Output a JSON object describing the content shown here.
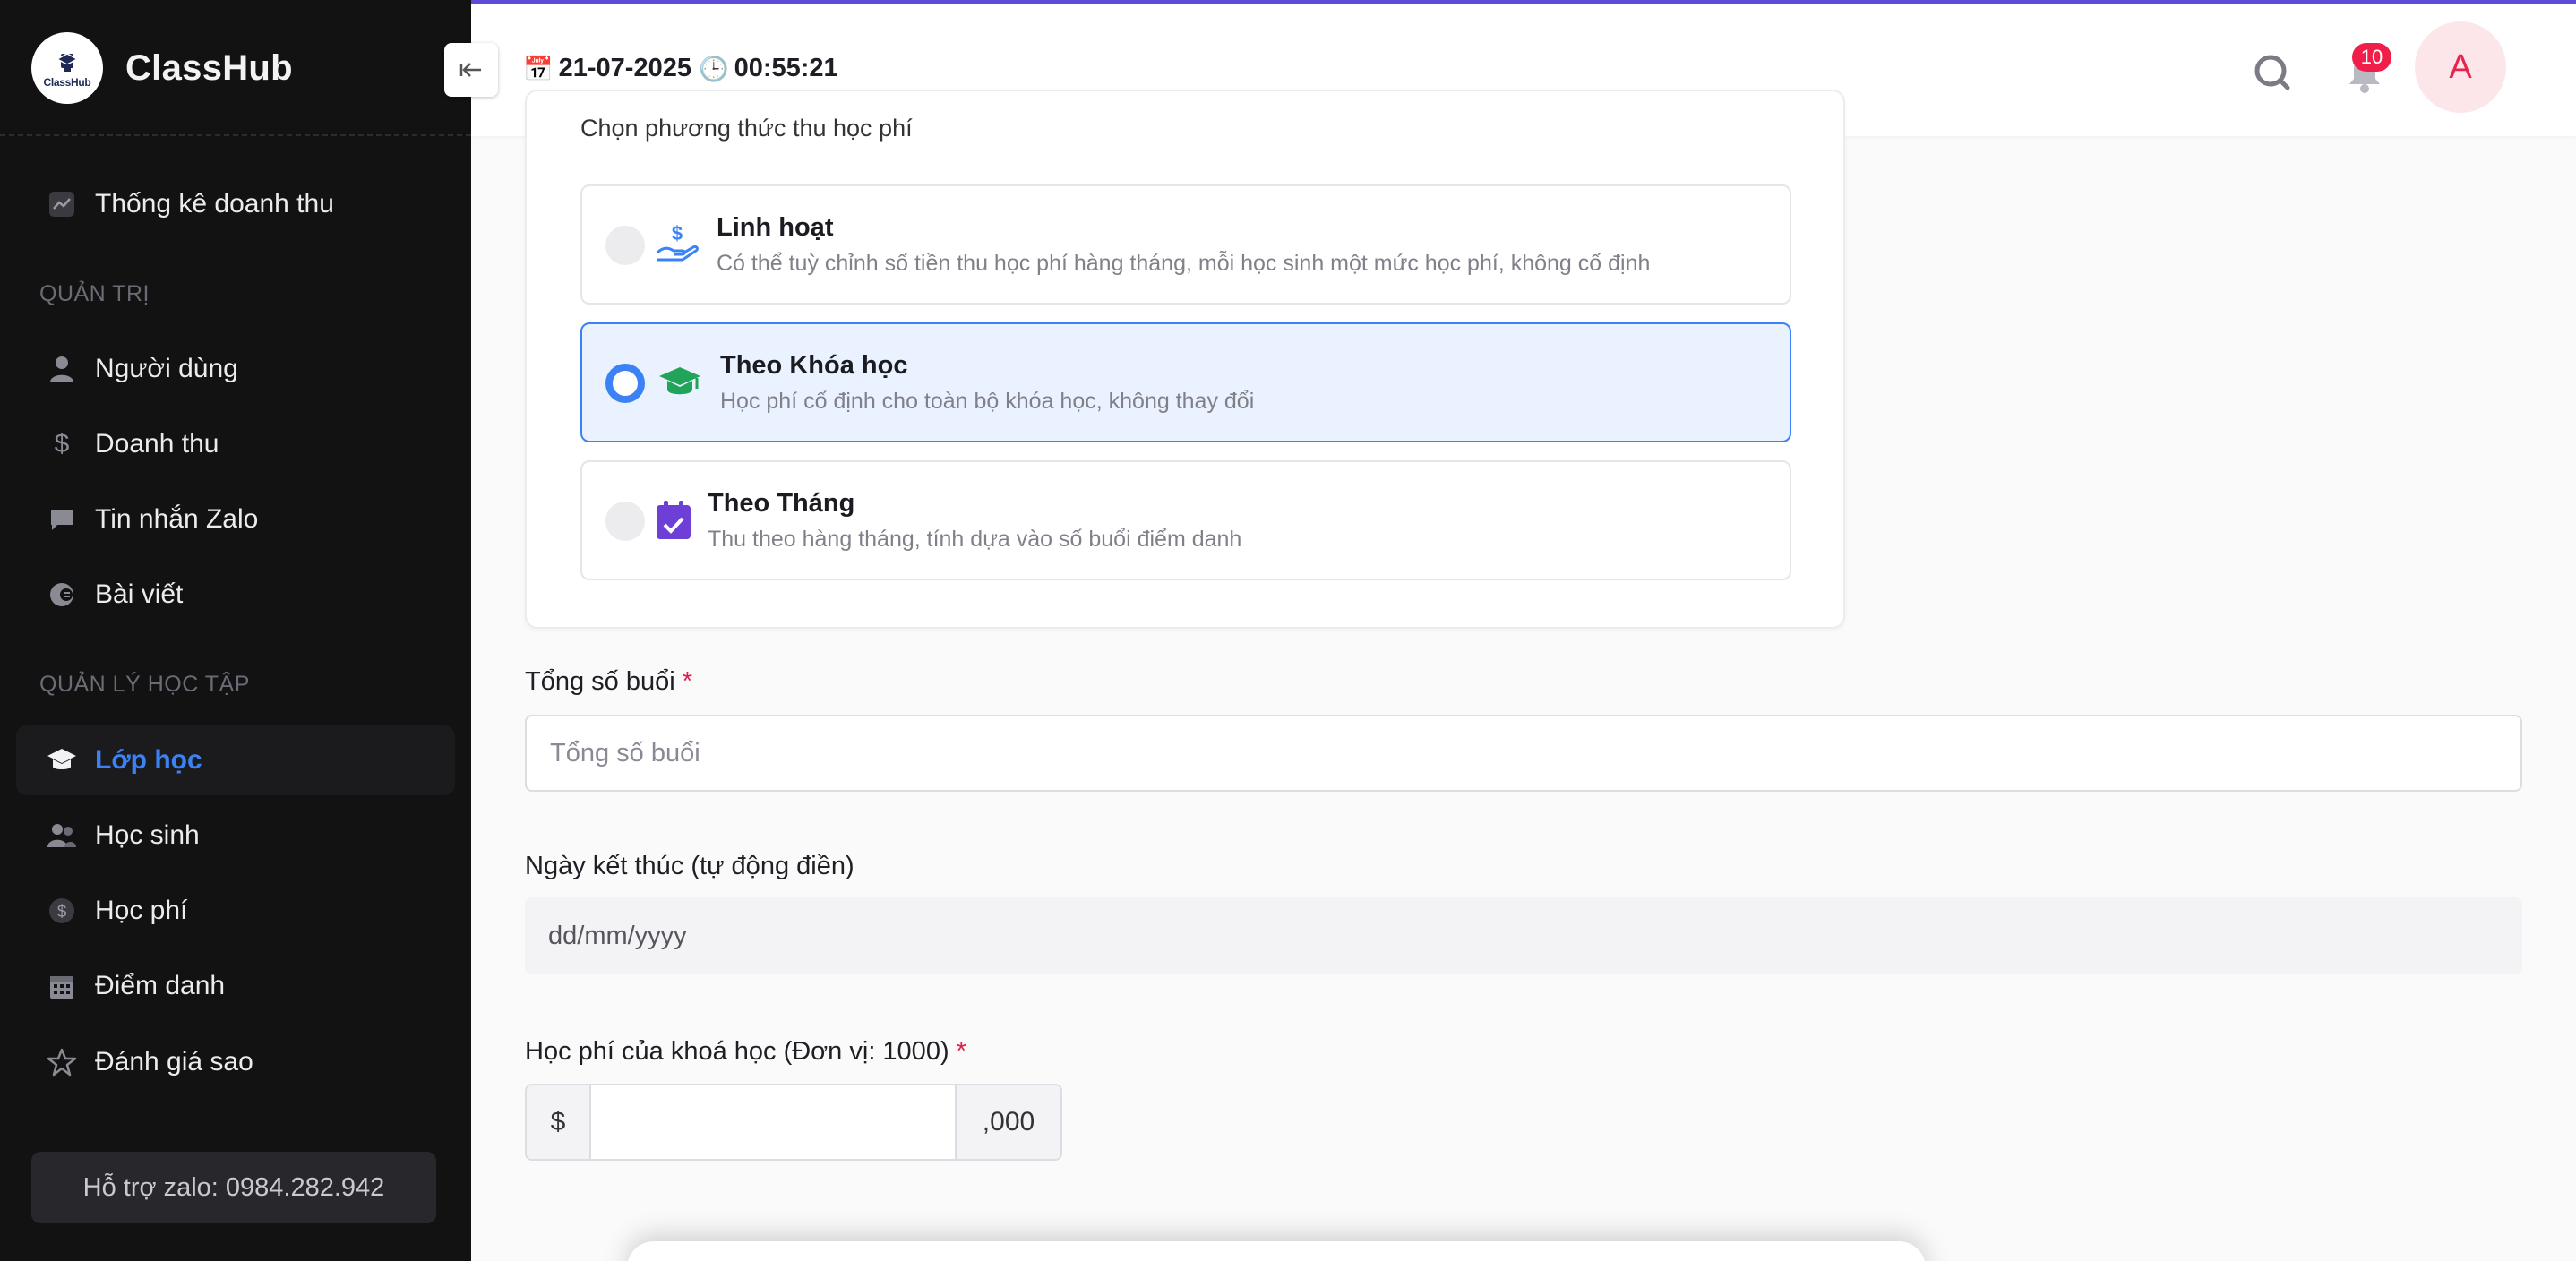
{
  "app": {
    "name": "ClassHub",
    "logo_text": "ClassHub"
  },
  "sidebar": {
    "top_items": [
      {
        "label": "Thống kê doanh thu",
        "icon": "chart-icon"
      }
    ],
    "sections": [
      {
        "title": "QUẢN TRỊ",
        "items": [
          {
            "label": "Người dùng",
            "icon": "user-icon"
          },
          {
            "label": "Doanh thu",
            "icon": "dollar-icon"
          },
          {
            "label": "Tin nhắn Zalo",
            "icon": "message-icon"
          },
          {
            "label": "Bài viết",
            "icon": "article-icon"
          }
        ]
      },
      {
        "title": "QUẢN LÝ HỌC TẬP",
        "items": [
          {
            "label": "Lớp học",
            "icon": "graduation-cap-icon",
            "active": true
          },
          {
            "label": "Học sinh",
            "icon": "users-icon"
          },
          {
            "label": "Học phí",
            "icon": "coin-icon"
          },
          {
            "label": "Điểm danh",
            "icon": "calendar-icon"
          },
          {
            "label": "Đánh giá sao",
            "icon": "star-icon"
          }
        ]
      }
    ],
    "support": "Hỗ trợ zalo: 0984.282.942"
  },
  "header": {
    "date": "21-07-2025",
    "time": "00:55:21",
    "notification_count": "10",
    "avatar_letter": "A"
  },
  "fee_method": {
    "caption": "Chọn phương thức thu học phí",
    "options": [
      {
        "title": "Linh hoạt",
        "description": "Có thể tuỳ chỉnh số tiền thu học phí hàng tháng, mỗi học sinh một mức học phí, không cố định",
        "icon": "hand-dollar-icon",
        "selected": false
      },
      {
        "title": "Theo Khóa học",
        "description": "Học phí cố định cho toàn bộ khóa học, không thay đổi",
        "icon": "graduation-cap-icon",
        "selected": true
      },
      {
        "title": "Theo Tháng",
        "description": "Thu theo hàng tháng, tính dựa vào số buổi điểm danh",
        "icon": "calendar-check-icon",
        "selected": false
      }
    ]
  },
  "form": {
    "sessions": {
      "label": "Tổng số buổi",
      "required_mark": "*",
      "placeholder": "Tổng số buổi"
    },
    "end_date": {
      "label": "Ngày kết thúc (tự động điền)",
      "value": "dd/mm/yyyy"
    },
    "course_fee": {
      "label": "Học phí của khoá học (Đơn vị: 1000)",
      "required_mark": "*",
      "prefix": "$",
      "suffix": ",000",
      "value": ""
    }
  },
  "colors": {
    "accent": "#3b82f6",
    "sidebar_bg": "#121212",
    "required": "#e11d48",
    "badge": "#ef1f4a",
    "header_border": "#5b4bd6"
  }
}
